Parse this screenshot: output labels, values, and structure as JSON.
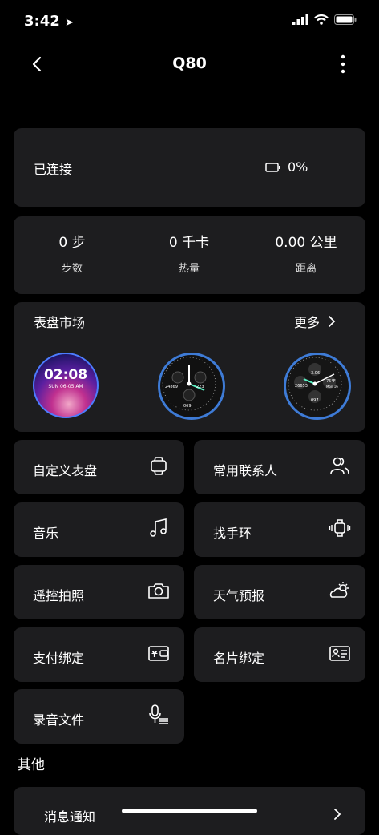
{
  "status": {
    "time": "3:42"
  },
  "header": {
    "title": "Q80"
  },
  "connection": {
    "status": "已连接",
    "battery": "0%"
  },
  "stats": [
    {
      "value": "0 步",
      "label": "步数"
    },
    {
      "value": "0 千卡",
      "label": "热量"
    },
    {
      "value": "0.00 公里",
      "label": "距离"
    }
  ],
  "market": {
    "title": "表盘市场",
    "more": "更多",
    "face1_time": "02:08",
    "face1_date": "SUN  06-05  AM",
    "face2_steps": "24869",
    "face2_cal": "223",
    "face2_hr": "069",
    "face3_steps": "26653",
    "face3_dist": "3.06",
    "face3_hr": "097",
    "face3_temp": "75°F",
    "face3_day": "Mon 16"
  },
  "features": [
    {
      "label": "自定义表盘",
      "icon": "watch-face-icon"
    },
    {
      "label": "常用联系人",
      "icon": "contacts-icon"
    },
    {
      "label": "音乐",
      "icon": "music-note-icon"
    },
    {
      "label": "找手环",
      "icon": "vibrate-watch-icon"
    },
    {
      "label": "遥控拍照",
      "icon": "camera-icon"
    },
    {
      "label": "天气预报",
      "icon": "weather-icon"
    },
    {
      "label": "支付绑定",
      "icon": "wallet-icon"
    },
    {
      "label": "名片绑定",
      "icon": "business-card-icon"
    },
    {
      "label": "录音文件",
      "icon": "microphone-icon"
    }
  ],
  "other": {
    "title": "其他",
    "notification": "消息通知"
  }
}
